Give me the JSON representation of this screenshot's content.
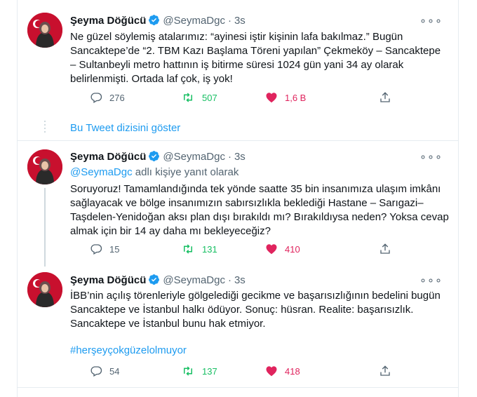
{
  "tweets": [
    {
      "name": "Şeyma Döğücü",
      "handle": "@SeymaDgc",
      "time": "3s",
      "text": "Ne güzel söylemiş atalarımız: “ayinesi iştir kişinin lafa bakılmaz.” Bugün Sancaktepe’de “2. TBM Kazı Başlama Töreni yapılan” Çekmeköy – Sancaktepe – Sultanbeyli metro hattının iş bitirme süresi 1024 gün yani 34 ay olarak belirlenmişti. Ortada laf çok, iş yok!",
      "replies": "276",
      "retweets": "507",
      "likes": "1,6 B"
    },
    {
      "name": "Şeyma Döğücü",
      "handle": "@SeymaDgc",
      "time": "3s",
      "reply_to_handle": "@SeymaDgc",
      "reply_to_suffix": " adlı kişiye yanıt olarak",
      "text": "Soruyoruz! Tamamlandığında tek yönde saatte 35 bin insanımıza ulaşım imkânı sağlayacak ve bölge insanımızın sabırsızlıkla beklediği Hastane – Sarıgazi–Taşdelen-Yenidoğan aksı plan dışı bırakıldı mı? Bırakıldıysa neden? Yoksa cevap almak için bir 14 ay daha mı bekleyeceğiz?",
      "replies": "15",
      "retweets": "131",
      "likes": "410"
    },
    {
      "name": "Şeyma Döğücü",
      "handle": "@SeymaDgc",
      "time": "3s",
      "text": "İBB’nin açılış törenleriyle gölgelediği gecikme ve başarısızlığının bedelini bugün Sancaktepe ve İstanbul halkı ödüyor. Sonuç: hüsran. Realite: başarısızlık. Sancaktepe ve İstanbul bunu hak etmiyor.",
      "hashtag": "#herşeyçokgüzelolmuyor",
      "replies": "54",
      "retweets": "137",
      "likes": "418"
    }
  ],
  "show_thread_label": "Bu Tweet dizisini göster",
  "more_label": "∘∘∘",
  "colors": {
    "link": "#1d9bf0",
    "retweet": "#17bf63",
    "like": "#e0245e",
    "muted": "#536471"
  }
}
